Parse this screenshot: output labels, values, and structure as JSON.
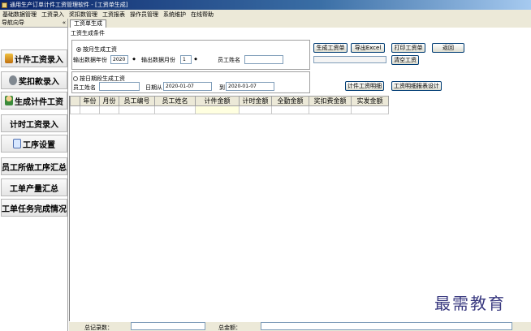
{
  "window": {
    "title": "通用生产订单计件工资管理软件 - [工资单生成]"
  },
  "menu": [
    "基础数据管理",
    "工资录入",
    "奖扣数管理",
    "工资报表",
    "操作员管理",
    "系统维护",
    "在线帮助"
  ],
  "sidebar": {
    "header": "导航向导",
    "collapse_glyph": "«",
    "items": [
      {
        "label": "计件工资录入",
        "icon": "bar-chart-icon"
      },
      {
        "label": "奖扣款录入",
        "icon": "gear-icon"
      },
      {
        "label": "生成计件工资",
        "icon": "person-icon"
      },
      {
        "label": "计时工资录入",
        "icon": ""
      },
      {
        "label": "工序设置",
        "icon": "document-icon"
      },
      {
        "label": "员工所做工序汇总",
        "icon": ""
      },
      {
        "label": "工单产量汇总",
        "icon": ""
      },
      {
        "label": "工单任务完成情况",
        "icon": ""
      }
    ]
  },
  "tab": {
    "label": "工资单生成"
  },
  "form": {
    "group_title": "工资生成条件",
    "monthly": {
      "radio_label": "按月生成工资",
      "year_label": "输出数据年份",
      "year_value": "2020",
      "month_label": "输出数据月份",
      "month_value": "1",
      "employee_label": "员工姓名",
      "employee_value": ""
    },
    "by_date": {
      "radio_label": "按日期段生成工资",
      "employee_label": "员工姓名",
      "employee_value": "",
      "from_label": "日期从",
      "from_value": "2020-01-07",
      "to_label": "到",
      "to_value": "2020-01-07"
    },
    "buttons": {
      "generate": "生成工资单",
      "export": "导出Excel",
      "print": "打印工资单",
      "back": "返回",
      "clear": "清空工资",
      "piece_detail": "计件工资明细",
      "report_design": "工资明细报表设计"
    }
  },
  "grid": {
    "columns": [
      "年份",
      "月份",
      "员工编号",
      "员工姓名",
      "计件金额",
      "计时金额",
      "全勤金额",
      "奖扣费金额",
      "实发金额"
    ]
  },
  "status": {
    "records_label": "总记录数：",
    "amount_label": "总金额："
  },
  "watermark": "最需教育"
}
